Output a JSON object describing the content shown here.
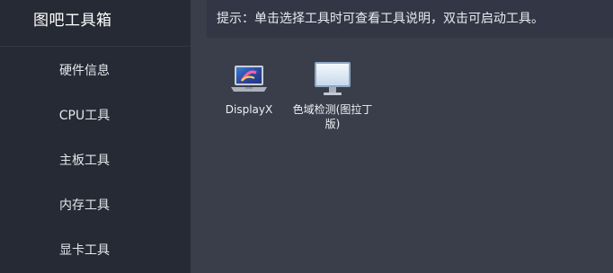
{
  "sidebar": {
    "title": "图吧工具箱",
    "items": [
      {
        "label": "硬件信息"
      },
      {
        "label": "CPU工具"
      },
      {
        "label": "主板工具"
      },
      {
        "label": "内存工具"
      },
      {
        "label": "显卡工具"
      }
    ]
  },
  "main": {
    "tip": "提示：单击选择工具时可查看工具说明，双击可启动工具。",
    "tools": [
      {
        "label": "DisplayX",
        "icon": "laptop-icon"
      },
      {
        "label": "色域检测(图拉丁版)",
        "icon": "monitor-icon"
      }
    ]
  },
  "colors": {
    "sidebar_bg": "#262a34",
    "main_bg": "#3a3e4b",
    "tip_bg": "#333745",
    "text": "#ffffff"
  }
}
